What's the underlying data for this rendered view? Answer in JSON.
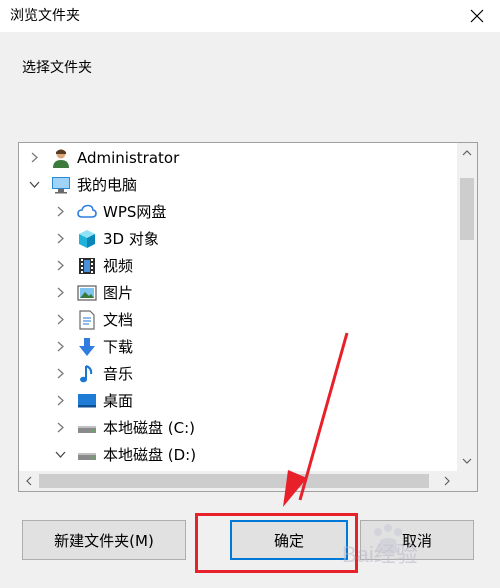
{
  "window": {
    "title": "浏览文件夹",
    "close_icon": "close-icon"
  },
  "instruction": "选择文件夹",
  "tree": {
    "items": [
      {
        "label": "Administrator",
        "icon": "user-icon",
        "expanded": false,
        "level": 0
      },
      {
        "label": "我的电脑",
        "icon": "computer-icon",
        "expanded": true,
        "level": 0
      },
      {
        "label": "WPS网盘",
        "icon": "cloud-icon",
        "expanded": false,
        "level": 1
      },
      {
        "label": "3D 对象",
        "icon": "cube-icon",
        "expanded": false,
        "level": 1
      },
      {
        "label": "视频",
        "icon": "video-icon",
        "expanded": false,
        "level": 1
      },
      {
        "label": "图片",
        "icon": "picture-icon",
        "expanded": false,
        "level": 1
      },
      {
        "label": "文档",
        "icon": "document-icon",
        "expanded": false,
        "level": 1
      },
      {
        "label": "下载",
        "icon": "download-icon",
        "expanded": false,
        "level": 1
      },
      {
        "label": "音乐",
        "icon": "music-icon",
        "expanded": false,
        "level": 1
      },
      {
        "label": "桌面",
        "icon": "desktop-icon",
        "expanded": false,
        "level": 1
      },
      {
        "label": "本地磁盘 (C:)",
        "icon": "drive-icon",
        "expanded": false,
        "level": 1
      },
      {
        "label": "本地磁盘 (D:)",
        "icon": "drive-icon",
        "expanded": true,
        "level": 1
      }
    ]
  },
  "buttons": {
    "new_folder": "新建文件夹(M)",
    "ok": "确定",
    "cancel": "取消"
  },
  "annotation": {
    "highlight_color": "#e8202a",
    "target": "确定"
  },
  "watermark": {
    "text": "Bai经验"
  },
  "colors": {
    "accent": "#0078d7",
    "annotation": "#e8202a"
  }
}
